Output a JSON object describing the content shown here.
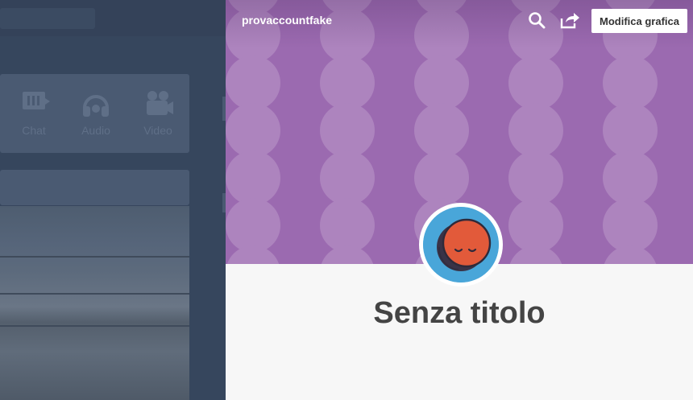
{
  "background": {
    "post_types": [
      {
        "label": "Chat",
        "icon": "chat-icon"
      },
      {
        "label": "Audio",
        "icon": "headphones-icon"
      },
      {
        "label": "Video",
        "icon": "video-camera-icon"
      }
    ]
  },
  "blog": {
    "name": "provaccountfake",
    "title": "Senza titolo",
    "edit_button_label": "Modifica grafica",
    "search_icon": "search-icon",
    "share_icon": "share-icon",
    "avatar_icon": "sleeping-face-avatar",
    "header_color": "#9b6ab0",
    "dot_color": "#ad84be",
    "avatar_bg": "#49a6d9",
    "avatar_face": "#e25a3a"
  }
}
